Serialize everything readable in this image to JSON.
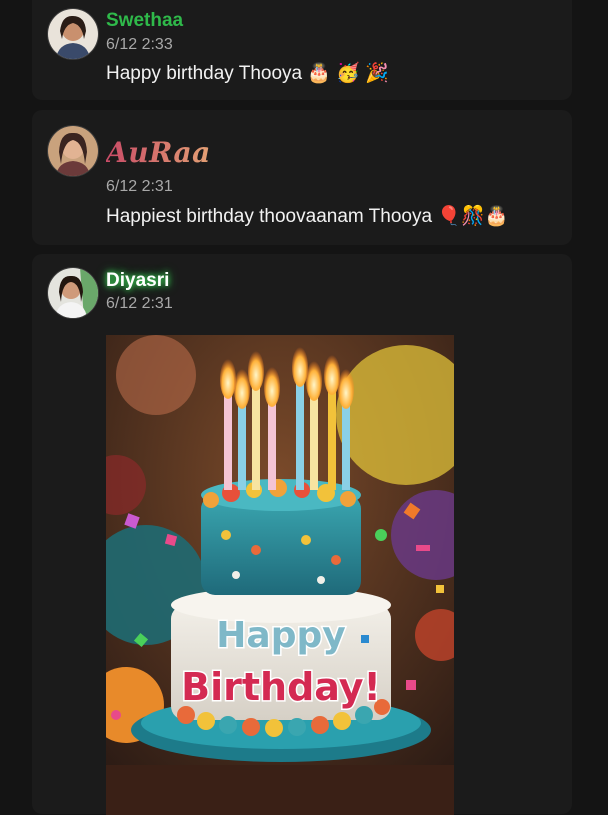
{
  "messages": [
    {
      "author": "Swethaa",
      "time": "6/12 2:33",
      "text": "Happy birthday Thooya 🎂 🥳 🎉"
    },
    {
      "author": "AuRaa",
      "time": "6/12 2:31",
      "text": "Happiest birthday thoovaanam Thooya 🎈🎊🎂"
    },
    {
      "author": "Diyasri",
      "time": "6/12 2:31",
      "gif_text_line1": "Happy",
      "gif_text_line2": "Birthday!"
    }
  ],
  "colors": {
    "background": "#141414",
    "card": "#1b1b1b",
    "name_green": "#2fb94a"
  }
}
